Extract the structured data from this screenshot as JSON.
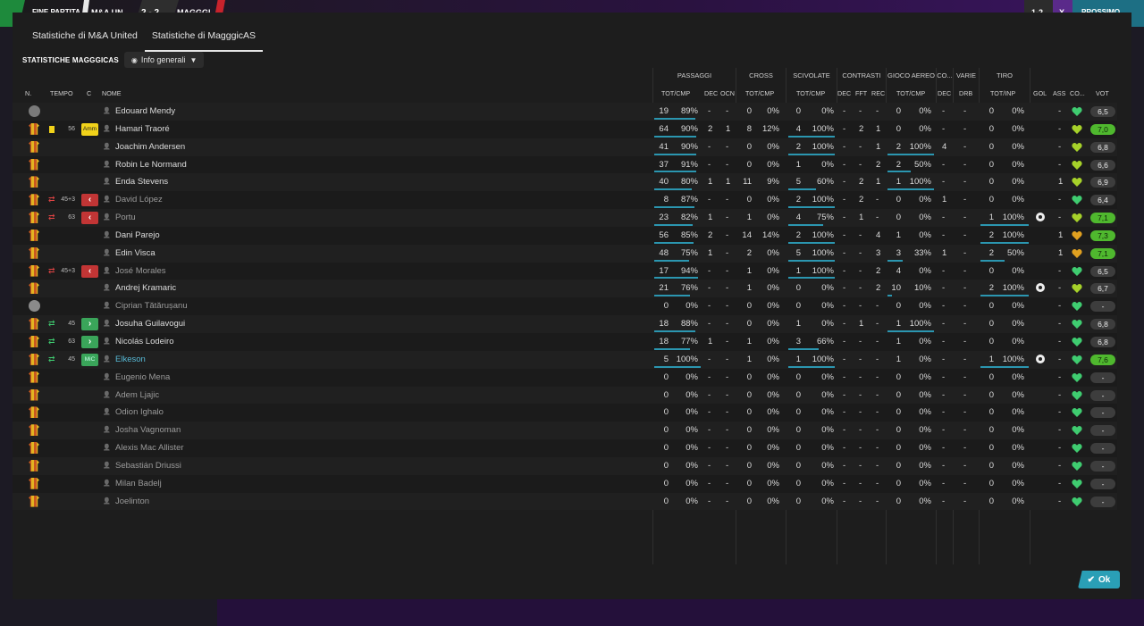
{
  "topbar": {
    "left_label": "FINE PARTITA",
    "home_abbr": "M&A UN",
    "score": "2 - 2",
    "away_abbr": "MAGGGI",
    "right_score": "1-2",
    "close_label": "X",
    "right_button": "PROSSIMO"
  },
  "tabs": [
    "Statistiche di M&A United",
    "Statistiche di MagggicAS"
  ],
  "active_tab": 1,
  "section_title": "STATISTICHE MAGGGICAS",
  "dropdown": {
    "label": "Info generali"
  },
  "groups": [
    "PASSAGGI",
    "CROSS",
    "SCIVOLATE",
    "CONTRASTI",
    "GIOCO AEREO",
    "CO...",
    "VARIE",
    "TIRO"
  ],
  "columns": {
    "n": "N.",
    "tempo": "TEMPO",
    "c": "C",
    "nome": "NOME",
    "pass_tot": "TOT/CMP",
    "pass_dec": "DEC",
    "pass_ocn": "OCN",
    "cross_tot": "TOT/CMP",
    "sciv_tot": "TOT/CMP",
    "con_dec": "DEC",
    "con_fft": "FFT",
    "con_rec": "REC",
    "aereo_tot": "TOT/CMP",
    "co_dec": "DEC",
    "varie_drb": "DRB",
    "tiro_tot": "TOT/INP",
    "gol": "GOL",
    "ass": "ASS",
    "co": "CO...",
    "vot": "VOT"
  },
  "rows": [
    {
      "shirt": "gk",
      "card": "",
      "swap": "",
      "mins": "",
      "badge": "",
      "name": "Edouard Mendy",
      "style": "",
      "pt": "19",
      "pp": "89%",
      "pbar": 89,
      "pdec": "-",
      "pocn": "-",
      "ct": "0",
      "cp": "0%",
      "st": "0",
      "sp": "0%",
      "sbar": 0,
      "cdec": "-",
      "cfft": "-",
      "crec": "-",
      "at": "0",
      "ap": "0%",
      "abar": 0,
      "codec": "-",
      "drb": "-",
      "tt": "0",
      "tp": "0%",
      "tbar": 0,
      "gol": "",
      "ass": "-",
      "heart": "green",
      "vot": "6,5",
      "vg": false
    },
    {
      "shirt": "f",
      "card": "yellow",
      "swap": "",
      "mins": "56",
      "badge": "Amm",
      "name": "Hamari Traoré",
      "style": "",
      "pt": "64",
      "pp": "90%",
      "pbar": 90,
      "pdec": "2",
      "pocn": "1",
      "ct": "8",
      "cp": "12%",
      "st": "4",
      "sp": "100%",
      "sbar": 100,
      "cdec": "-",
      "cfft": "2",
      "crec": "1",
      "at": "0",
      "ap": "0%",
      "abar": 0,
      "codec": "-",
      "drb": "-",
      "tt": "0",
      "tp": "0%",
      "tbar": 0,
      "gol": "",
      "ass": "-",
      "heart": "lime",
      "vot": "7,0",
      "vg": true
    },
    {
      "shirt": "f",
      "card": "",
      "swap": "",
      "mins": "",
      "badge": "",
      "name": "Joachim Andersen",
      "style": "",
      "pt": "41",
      "pp": "90%",
      "pbar": 90,
      "pdec": "-",
      "pocn": "-",
      "ct": "0",
      "cp": "0%",
      "st": "2",
      "sp": "100%",
      "sbar": 100,
      "cdec": "-",
      "cfft": "-",
      "crec": "1",
      "at": "2",
      "ap": "100%",
      "abar": 100,
      "codec": "4",
      "drb": "-",
      "tt": "0",
      "tp": "0%",
      "tbar": 0,
      "gol": "",
      "ass": "-",
      "heart": "lime",
      "vot": "6,8",
      "vg": false
    },
    {
      "shirt": "f",
      "card": "",
      "swap": "",
      "mins": "",
      "badge": "",
      "name": "Robin Le Normand",
      "style": "",
      "pt": "37",
      "pp": "91%",
      "pbar": 91,
      "pdec": "-",
      "pocn": "-",
      "ct": "0",
      "cp": "0%",
      "st": "1",
      "sp": "0%",
      "sbar": 0,
      "cdec": "-",
      "cfft": "-",
      "crec": "2",
      "at": "2",
      "ap": "50%",
      "abar": 50,
      "codec": "-",
      "drb": "-",
      "tt": "0",
      "tp": "0%",
      "tbar": 0,
      "gol": "",
      "ass": "-",
      "heart": "lime",
      "vot": "6,6",
      "vg": false
    },
    {
      "shirt": "f",
      "card": "",
      "swap": "",
      "mins": "",
      "badge": "",
      "name": "Enda Stevens",
      "style": "",
      "pt": "40",
      "pp": "80%",
      "pbar": 80,
      "pdec": "1",
      "pocn": "1",
      "ct": "11",
      "cp": "9%",
      "st": "5",
      "sp": "60%",
      "sbar": 60,
      "cdec": "-",
      "cfft": "2",
      "crec": "1",
      "at": "1",
      "ap": "100%",
      "abar": 100,
      "codec": "-",
      "drb": "-",
      "tt": "0",
      "tp": "0%",
      "tbar": 0,
      "gol": "",
      "ass": "1",
      "heart": "lime",
      "vot": "6,9",
      "vg": false
    },
    {
      "shirt": "f",
      "card": "",
      "swap": "off",
      "mins": "45+3",
      "badge": "out",
      "name": "David López",
      "style": "sub",
      "pt": "8",
      "pp": "87%",
      "pbar": 87,
      "pdec": "-",
      "pocn": "-",
      "ct": "0",
      "cp": "0%",
      "st": "2",
      "sp": "100%",
      "sbar": 100,
      "cdec": "-",
      "cfft": "2",
      "crec": "-",
      "at": "0",
      "ap": "0%",
      "abar": 0,
      "codec": "1",
      "drb": "-",
      "tt": "0",
      "tp": "0%",
      "tbar": 0,
      "gol": "",
      "ass": "-",
      "heart": "green",
      "vot": "6,4",
      "vg": false
    },
    {
      "shirt": "f",
      "card": "",
      "swap": "off",
      "mins": "63",
      "badge": "out",
      "name": "Portu",
      "style": "sub",
      "pt": "23",
      "pp": "82%",
      "pbar": 82,
      "pdec": "1",
      "pocn": "-",
      "ct": "1",
      "cp": "0%",
      "st": "4",
      "sp": "75%",
      "sbar": 75,
      "cdec": "-",
      "cfft": "1",
      "crec": "-",
      "at": "0",
      "ap": "0%",
      "abar": 0,
      "codec": "-",
      "drb": "-",
      "tt": "1",
      "tp": "100%",
      "tbar": 100,
      "gol": "ball",
      "ass": "-",
      "heart": "lime",
      "vot": "7,1",
      "vg": true
    },
    {
      "shirt": "f",
      "card": "",
      "swap": "",
      "mins": "",
      "badge": "",
      "name": "Dani Parejo",
      "style": "",
      "pt": "56",
      "pp": "85%",
      "pbar": 85,
      "pdec": "2",
      "pocn": "-",
      "ct": "14",
      "cp": "14%",
      "st": "2",
      "sp": "100%",
      "sbar": 100,
      "cdec": "-",
      "cfft": "-",
      "crec": "4",
      "at": "1",
      "ap": "0%",
      "abar": 0,
      "codec": "-",
      "drb": "-",
      "tt": "2",
      "tp": "100%",
      "tbar": 100,
      "gol": "",
      "ass": "1",
      "heart": "orange",
      "vot": "7,3",
      "vg": true
    },
    {
      "shirt": "f",
      "card": "",
      "swap": "",
      "mins": "",
      "badge": "",
      "name": "Edin Visca",
      "style": "",
      "pt": "48",
      "pp": "75%",
      "pbar": 75,
      "pdec": "1",
      "pocn": "-",
      "ct": "2",
      "cp": "0%",
      "st": "5",
      "sp": "100%",
      "sbar": 100,
      "cdec": "-",
      "cfft": "-",
      "crec": "3",
      "at": "3",
      "ap": "33%",
      "abar": 33,
      "codec": "1",
      "drb": "-",
      "tt": "2",
      "tp": "50%",
      "tbar": 50,
      "gol": "",
      "ass": "1",
      "heart": "orange",
      "vot": "7,1",
      "vg": true
    },
    {
      "shirt": "f",
      "card": "",
      "swap": "off",
      "mins": "45+3",
      "badge": "out",
      "name": "José Morales",
      "style": "sub",
      "pt": "17",
      "pp": "94%",
      "pbar": 94,
      "pdec": "-",
      "pocn": "-",
      "ct": "1",
      "cp": "0%",
      "st": "1",
      "sp": "100%",
      "sbar": 100,
      "cdec": "-",
      "cfft": "-",
      "crec": "2",
      "at": "4",
      "ap": "0%",
      "abar": 0,
      "codec": "-",
      "drb": "-",
      "tt": "0",
      "tp": "0%",
      "tbar": 0,
      "gol": "",
      "ass": "-",
      "heart": "green",
      "vot": "6,5",
      "vg": false
    },
    {
      "shirt": "f",
      "card": "",
      "swap": "",
      "mins": "",
      "badge": "",
      "name": "Andrej Kramaric",
      "style": "",
      "pt": "21",
      "pp": "76%",
      "pbar": 76,
      "pdec": "-",
      "pocn": "-",
      "ct": "1",
      "cp": "0%",
      "st": "0",
      "sp": "0%",
      "sbar": 0,
      "cdec": "-",
      "cfft": "-",
      "crec": "2",
      "at": "10",
      "ap": "10%",
      "abar": 10,
      "codec": "-",
      "drb": "-",
      "tt": "2",
      "tp": "100%",
      "tbar": 100,
      "gol": "ball",
      "ass": "-",
      "heart": "lime",
      "vot": "6,7",
      "vg": false
    },
    {
      "shirt": "gk2",
      "card": "",
      "swap": "",
      "mins": "",
      "badge": "",
      "name": "Ciprian Tătărușanu",
      "style": "sub",
      "pt": "0",
      "pp": "0%",
      "pbar": 0,
      "pdec": "-",
      "pocn": "-",
      "ct": "0",
      "cp": "0%",
      "st": "0",
      "sp": "0%",
      "sbar": 0,
      "cdec": "-",
      "cfft": "-",
      "crec": "-",
      "at": "0",
      "ap": "0%",
      "abar": 0,
      "codec": "-",
      "drb": "-",
      "tt": "0",
      "tp": "0%",
      "tbar": 0,
      "gol": "",
      "ass": "-",
      "heart": "green",
      "vot": "-",
      "vg": false
    },
    {
      "shirt": "f",
      "card": "",
      "swap": "on",
      "mins": "45",
      "badge": "in",
      "name": "Josuha Guilavogui",
      "style": "",
      "pt": "18",
      "pp": "88%",
      "pbar": 88,
      "pdec": "-",
      "pocn": "-",
      "ct": "0",
      "cp": "0%",
      "st": "1",
      "sp": "0%",
      "sbar": 0,
      "cdec": "-",
      "cfft": "1",
      "crec": "-",
      "at": "1",
      "ap": "100%",
      "abar": 100,
      "codec": "-",
      "drb": "-",
      "tt": "0",
      "tp": "0%",
      "tbar": 0,
      "gol": "",
      "ass": "-",
      "heart": "green",
      "vot": "6,8",
      "vg": false
    },
    {
      "shirt": "f",
      "card": "",
      "swap": "on",
      "mins": "63",
      "badge": "in",
      "name": "Nicolás Lodeiro",
      "style": "",
      "pt": "18",
      "pp": "77%",
      "pbar": 77,
      "pdec": "1",
      "pocn": "-",
      "ct": "1",
      "cp": "0%",
      "st": "3",
      "sp": "66%",
      "sbar": 66,
      "cdec": "-",
      "cfft": "-",
      "crec": "-",
      "at": "1",
      "ap": "0%",
      "abar": 0,
      "codec": "-",
      "drb": "-",
      "tt": "0",
      "tp": "0%",
      "tbar": 0,
      "gol": "",
      "ass": "-",
      "heart": "green",
      "vot": "6,8",
      "vg": false
    },
    {
      "shirt": "f",
      "card": "",
      "swap": "on",
      "mins": "45",
      "badge": "MiC",
      "name": "Elkeson",
      "style": "hl",
      "pt": "5",
      "pp": "100%",
      "pbar": 100,
      "pdec": "-",
      "pocn": "-",
      "ct": "1",
      "cp": "0%",
      "st": "1",
      "sp": "100%",
      "sbar": 100,
      "cdec": "-",
      "cfft": "-",
      "crec": "-",
      "at": "1",
      "ap": "0%",
      "abar": 0,
      "codec": "-",
      "drb": "-",
      "tt": "1",
      "tp": "100%",
      "tbar": 100,
      "gol": "ball",
      "ass": "-",
      "heart": "green",
      "vot": "7,6",
      "vg": true
    },
    {
      "shirt": "f",
      "card": "",
      "swap": "",
      "mins": "",
      "badge": "",
      "name": "Eugenio Mena",
      "style": "sub",
      "pt": "0",
      "pp": "0%",
      "pbar": 0,
      "pdec": "-",
      "pocn": "-",
      "ct": "0",
      "cp": "0%",
      "st": "0",
      "sp": "0%",
      "sbar": 0,
      "cdec": "-",
      "cfft": "-",
      "crec": "-",
      "at": "0",
      "ap": "0%",
      "abar": 0,
      "codec": "-",
      "drb": "-",
      "tt": "0",
      "tp": "0%",
      "tbar": 0,
      "gol": "",
      "ass": "-",
      "heart": "green",
      "vot": "-",
      "vg": false
    },
    {
      "shirt": "f",
      "card": "",
      "swap": "",
      "mins": "",
      "badge": "",
      "name": "Adem Ljajic",
      "style": "sub",
      "pt": "0",
      "pp": "0%",
      "pbar": 0,
      "pdec": "-",
      "pocn": "-",
      "ct": "0",
      "cp": "0%",
      "st": "0",
      "sp": "0%",
      "sbar": 0,
      "cdec": "-",
      "cfft": "-",
      "crec": "-",
      "at": "0",
      "ap": "0%",
      "abar": 0,
      "codec": "-",
      "drb": "-",
      "tt": "0",
      "tp": "0%",
      "tbar": 0,
      "gol": "",
      "ass": "-",
      "heart": "green",
      "vot": "-",
      "vg": false
    },
    {
      "shirt": "f",
      "card": "",
      "swap": "",
      "mins": "",
      "badge": "",
      "name": "Odion Ighalo",
      "style": "sub",
      "pt": "0",
      "pp": "0%",
      "pbar": 0,
      "pdec": "-",
      "pocn": "-",
      "ct": "0",
      "cp": "0%",
      "st": "0",
      "sp": "0%",
      "sbar": 0,
      "cdec": "-",
      "cfft": "-",
      "crec": "-",
      "at": "0",
      "ap": "0%",
      "abar": 0,
      "codec": "-",
      "drb": "-",
      "tt": "0",
      "tp": "0%",
      "tbar": 0,
      "gol": "",
      "ass": "-",
      "heart": "green",
      "vot": "-",
      "vg": false
    },
    {
      "shirt": "f",
      "card": "",
      "swap": "",
      "mins": "",
      "badge": "",
      "name": "Josha Vagnoman",
      "style": "sub",
      "pt": "0",
      "pp": "0%",
      "pbar": 0,
      "pdec": "-",
      "pocn": "-",
      "ct": "0",
      "cp": "0%",
      "st": "0",
      "sp": "0%",
      "sbar": 0,
      "cdec": "-",
      "cfft": "-",
      "crec": "-",
      "at": "0",
      "ap": "0%",
      "abar": 0,
      "codec": "-",
      "drb": "-",
      "tt": "0",
      "tp": "0%",
      "tbar": 0,
      "gol": "",
      "ass": "-",
      "heart": "green",
      "vot": "-",
      "vg": false
    },
    {
      "shirt": "f",
      "card": "",
      "swap": "",
      "mins": "",
      "badge": "",
      "name": "Alexis Mac Allister",
      "style": "sub",
      "pt": "0",
      "pp": "0%",
      "pbar": 0,
      "pdec": "-",
      "pocn": "-",
      "ct": "0",
      "cp": "0%",
      "st": "0",
      "sp": "0%",
      "sbar": 0,
      "cdec": "-",
      "cfft": "-",
      "crec": "-",
      "at": "0",
      "ap": "0%",
      "abar": 0,
      "codec": "-",
      "drb": "-",
      "tt": "0",
      "tp": "0%",
      "tbar": 0,
      "gol": "",
      "ass": "-",
      "heart": "green",
      "vot": "-",
      "vg": false
    },
    {
      "shirt": "f",
      "card": "",
      "swap": "",
      "mins": "",
      "badge": "",
      "name": "Sebastián Driussi",
      "style": "sub",
      "pt": "0",
      "pp": "0%",
      "pbar": 0,
      "pdec": "-",
      "pocn": "-",
      "ct": "0",
      "cp": "0%",
      "st": "0",
      "sp": "0%",
      "sbar": 0,
      "cdec": "-",
      "cfft": "-",
      "crec": "-",
      "at": "0",
      "ap": "0%",
      "abar": 0,
      "codec": "-",
      "drb": "-",
      "tt": "0",
      "tp": "0%",
      "tbar": 0,
      "gol": "",
      "ass": "-",
      "heart": "green",
      "vot": "-",
      "vg": false
    },
    {
      "shirt": "f",
      "card": "",
      "swap": "",
      "mins": "",
      "badge": "",
      "name": "Milan Badelj",
      "style": "sub",
      "pt": "0",
      "pp": "0%",
      "pbar": 0,
      "pdec": "-",
      "pocn": "-",
      "ct": "0",
      "cp": "0%",
      "st": "0",
      "sp": "0%",
      "sbar": 0,
      "cdec": "-",
      "cfft": "-",
      "crec": "-",
      "at": "0",
      "ap": "0%",
      "abar": 0,
      "codec": "-",
      "drb": "-",
      "tt": "0",
      "tp": "0%",
      "tbar": 0,
      "gol": "",
      "ass": "-",
      "heart": "green",
      "vot": "-",
      "vg": false
    },
    {
      "shirt": "f",
      "card": "",
      "swap": "",
      "mins": "",
      "badge": "",
      "name": "Joelinton",
      "style": "sub",
      "pt": "0",
      "pp": "0%",
      "pbar": 0,
      "pdec": "-",
      "pocn": "-",
      "ct": "0",
      "cp": "0%",
      "st": "0",
      "sp": "0%",
      "sbar": 0,
      "cdec": "-",
      "cfft": "-",
      "crec": "-",
      "at": "0",
      "ap": "0%",
      "abar": 0,
      "codec": "-",
      "drb": "-",
      "tt": "0",
      "tp": "0%",
      "tbar": 0,
      "gol": "",
      "ass": "-",
      "heart": "green",
      "vot": "-",
      "vg": false
    }
  ],
  "ok_label": "Ok",
  "colors": {
    "accent": "#2a9fb6",
    "rating_green": "#4fb82e",
    "heart_green": "#3fcc70",
    "heart_lime": "#a6d12a",
    "heart_orange": "#e0a020"
  }
}
